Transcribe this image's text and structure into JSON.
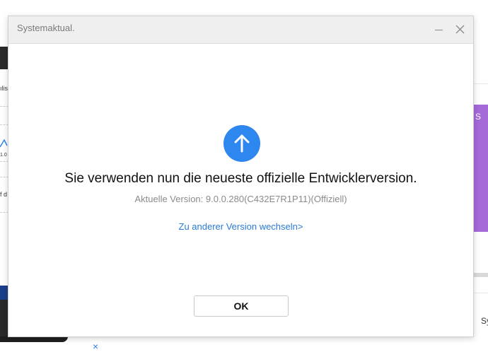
{
  "background": {
    "left_texts": [
      "ılis",
      "1.0",
      "f d"
    ],
    "right_purple_text": "S",
    "right_text": "Sy",
    "close_glyph": "×"
  },
  "dialog": {
    "title": "Systemaktual.",
    "minimize_glyph": "—",
    "headline": "Sie verwenden nun die neueste offizielle Entwicklerversion.",
    "version_text": "Aktuelle Version: 9.0.0.280(C432E7R1P11)(Offiziell)",
    "switch_link": "Zu anderer Version wechseln>",
    "ok_label": "OK",
    "accent_color": "#2e86ef",
    "icons": {
      "up": "arrow-up-icon",
      "close": "close-icon",
      "minimize": "minimize-icon"
    }
  }
}
